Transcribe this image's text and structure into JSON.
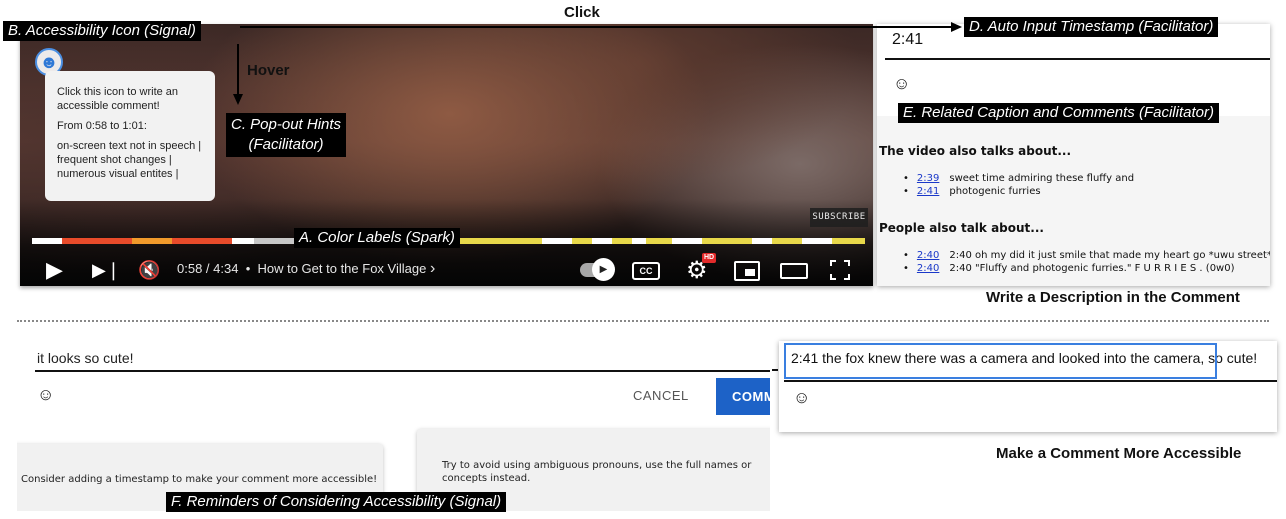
{
  "colors": {
    "label_bg": "#000000",
    "accent_blue": "#1d62c7",
    "highlight_blue": "#3a7fe0",
    "timeline_base": "#e8d84a",
    "timeline_segments": [
      "#e84b2a",
      "#f19a2b",
      "#ffffff",
      "#c7c7c7"
    ]
  },
  "annotations": {
    "click": "Click",
    "hover": "Hover",
    "a_color_labels": "A. Color Labels (Spark)",
    "b_accessibility_icon": "B. Accessibility Icon (Signal)",
    "c_popout_hints_line1": "C. Pop-out Hints",
    "c_popout_hints_line2": "(Facilitator)",
    "d_auto_timestamp": "D. Auto Input Timestamp (Facilitator)",
    "e_related": "E. Related Caption and Comments (Facilitator)",
    "f_reminders": "F. Reminders of Considering Accessibility (Signal)",
    "write_description": "Write a Description in the Comment",
    "more_accessible": "Make a Comment More Accessible"
  },
  "player": {
    "accessibility_icon": "accessibility-icon",
    "hint_lines": [
      "Click this icon to write an accessible comment!",
      "From 0:58 to 1:01:",
      "on-screen text not in speech | frequent shot changes | numerous visual entites |"
    ],
    "subscribe": "SUBSCRIBE",
    "time": "0:58 / 4:34",
    "separator": "•",
    "video_title": "How to Get to the Fox Village",
    "chevron": "›",
    "cc": "CC",
    "hd": "HD"
  },
  "timestamp_panel": {
    "value": "2:41",
    "emoji_icon": "smiley-icon"
  },
  "related": {
    "caption_heading": "The video also talks about...",
    "captions": [
      {
        "time": "2:39",
        "text": "sweet time admiring these fluffy and"
      },
      {
        "time": "2:41",
        "text": "photogenic furries"
      }
    ],
    "comments_heading": "People also talk about...",
    "comments": [
      {
        "time": "2:40",
        "text": "2:40 oh my did it just smile that made my heart go *uwu street*"
      },
      {
        "time": "2:40",
        "text": "2:40 \"Fluffy and photogenic furries.\" F U R R I E S . (0w0)"
      }
    ]
  },
  "comment_box": {
    "value": "it looks so cute!",
    "cancel": "CANCEL",
    "comment": "COMMENT",
    "reminder_left": "Consider adding a timestamp to make your comment more accessible!",
    "reminder_right": "Try to avoid using ambiguous pronouns, use the full names or concepts instead."
  },
  "accessible_comment": {
    "value": "2:41 the fox knew there was a camera and looked into the camera, so cute!"
  }
}
